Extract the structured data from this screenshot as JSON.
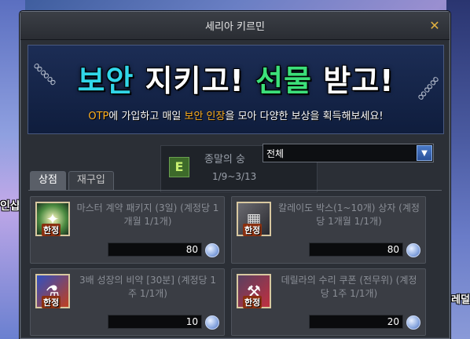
{
  "background": {
    "left_text": "인샵",
    "right_text": "기대레덜"
  },
  "window": {
    "title": "세리아 키르민"
  },
  "banner": {
    "headline": {
      "part1": "보안",
      "part2": " 지키고! ",
      "part3": "선물",
      "part4": " 받고!"
    },
    "subtitle": {
      "otp": "OTP",
      "text1": "에 가입하고 매일 ",
      "highlight": "보안 인장",
      "text2": "을 모아 다양한 보상을 획득해보세요!"
    }
  },
  "event": {
    "icon_letter": "E",
    "name": "종말의 숭",
    "date": "1/9~3/13"
  },
  "filter": {
    "selected": "전체"
  },
  "tabs": [
    {
      "label": "상점",
      "active": true
    },
    {
      "label": "재구입",
      "active": false
    }
  ],
  "items": [
    {
      "name": "마스터 계약 패키지 (3일) (계정당 1개월 1/1개)",
      "tag": "한정",
      "price": "80",
      "icon": "sparkle-icon"
    },
    {
      "name": "칼레이도 박스(1~10개) 상자 (계정당 1개월 1/1개)",
      "tag": "한정",
      "price": "80",
      "icon": "box-icon"
    },
    {
      "name": "3배 성장의 비약 [30분] (계정당 1주 1/1개)",
      "tag": "한정",
      "price": "10",
      "icon": "potion-icon"
    },
    {
      "name": "데릴라의 수리 쿠폰 (전무위) (계정당 1주 1/1개)",
      "tag": "한정",
      "price": "20",
      "icon": "repair-icon"
    }
  ],
  "colors": {
    "banner_cyan": "#31d6e8",
    "banner_green": "#3ce07a",
    "accent_orange": "#ffb020",
    "close_gold": "#e0b040"
  }
}
